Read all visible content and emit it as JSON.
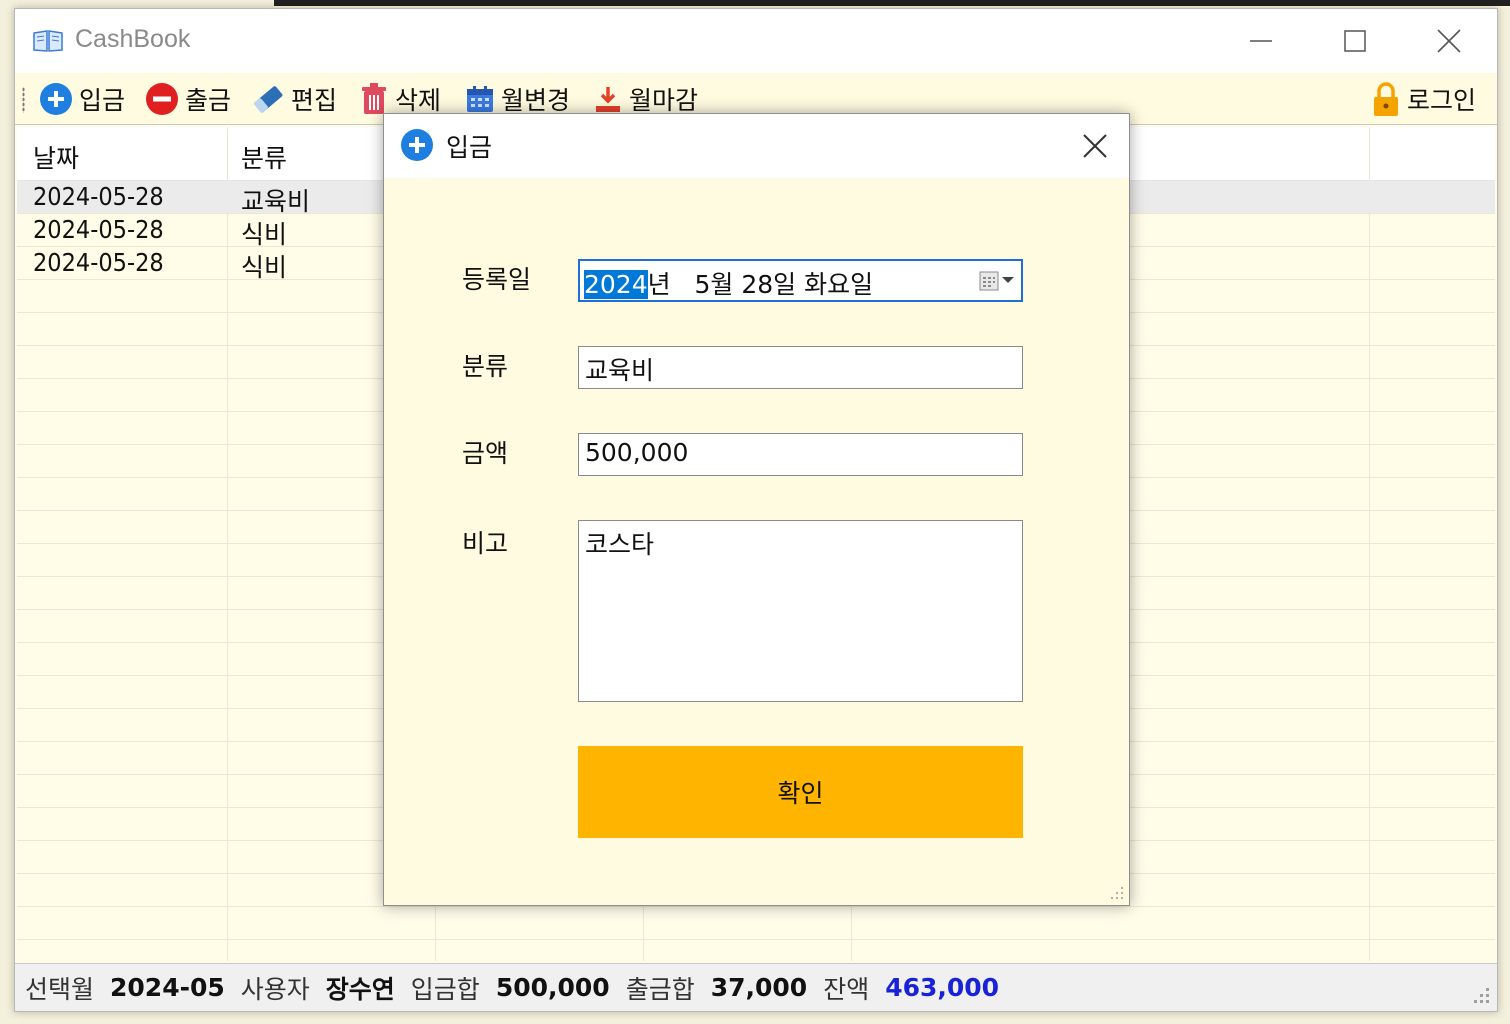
{
  "window": {
    "title": "CashBook"
  },
  "toolbar": {
    "items": [
      {
        "label": "입금",
        "icon": "plus-circle-icon"
      },
      {
        "label": "출금",
        "icon": "minus-circle-icon"
      },
      {
        "label": "편집",
        "icon": "eraser-icon"
      },
      {
        "label": "삭제",
        "icon": "trash-icon"
      },
      {
        "label": "월변경",
        "icon": "calendar-icon"
      },
      {
        "label": "월마감",
        "icon": "download-icon"
      }
    ],
    "login_label": "로그인",
    "accent_colors": {
      "plus": "#1e7fe0",
      "minus": "#e02020",
      "lock": "#f5a300"
    }
  },
  "grid": {
    "columns": [
      "날짜",
      "분류"
    ],
    "rows": [
      {
        "date": "2024-05-28",
        "category": "교육비",
        "selected": true
      },
      {
        "date": "2024-05-28",
        "category": "식비",
        "selected": false
      },
      {
        "date": "2024-05-28",
        "category": "식비",
        "selected": false
      }
    ]
  },
  "status": {
    "month_label": "선택월",
    "month_value": "2024-05",
    "user_label": "사용자",
    "user_value": "장수연",
    "income_label": "입금합",
    "income_value": "500,000",
    "expense_label": "출금합",
    "expense_value": "37,000",
    "balance_label": "잔액",
    "balance_value": "463,000",
    "balance_color": "#1a22d8"
  },
  "dialog": {
    "title": "입금",
    "date_label": "등록일",
    "date_year": "2024",
    "date_rest": "년   5월 28일 화요일",
    "category_label": "분류",
    "category_value": "교육비",
    "amount_label": "금액",
    "amount_value": "500,000",
    "memo_label": "비고",
    "memo_value": "코스타",
    "ok_label": "확인",
    "ok_color": "#ffb400"
  }
}
